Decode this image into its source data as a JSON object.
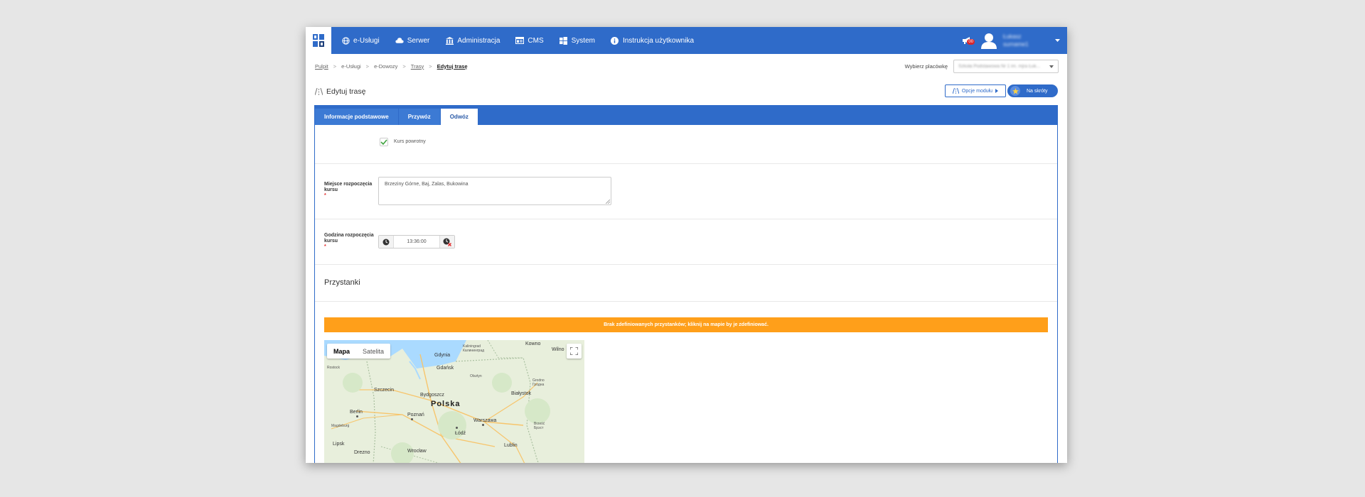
{
  "nav": {
    "items": [
      {
        "label": "e-Usługi",
        "icon": "globe-icon"
      },
      {
        "label": "Serwer",
        "icon": "cloud-icon"
      },
      {
        "label": "Administracja",
        "icon": "building-icon"
      },
      {
        "label": "CMS",
        "icon": "cms-icon"
      },
      {
        "label": "System",
        "icon": "windows-icon"
      },
      {
        "label": "Instrukcja użytkownika",
        "icon": "info-icon"
      }
    ],
    "notification_badge": "00",
    "user_name": "Łukasz",
    "user_surname": "surname1"
  },
  "breadcrumb": {
    "items": [
      "Pulpit",
      "e-Usługi",
      "e-Dowozy",
      "Trasy",
      "Edytuj trasę"
    ],
    "separator": ">"
  },
  "branch": {
    "label": "Wybierz placówkę",
    "value": "Szkoła Podstawowa Nr 1 im. mjra Łuk..."
  },
  "page": {
    "title": "Edytuj trasę",
    "options_button": "Opcje modułu",
    "shortcuts_button": "Na skróty"
  },
  "tabs": [
    "Informacje podstawowe",
    "Przywóz",
    "Odwóz"
  ],
  "form": {
    "return_course_label": "Kurs powrotny",
    "return_course_checked": true,
    "start_place_label": "Miejsce rozpoczęcia kursu",
    "start_place_value": "Brzeziny Górne, Baj, Zalas, Bukowina",
    "start_time_label": "Godzina rozpoczęcia kursu",
    "start_time_value": "13:36:00",
    "required_marker": "*"
  },
  "stops": {
    "title": "Przystanki",
    "alert": "Brak zdefiniowanych przystanków; kliknij na mapie by je zdefiniować."
  },
  "map": {
    "type_map": "Mapa",
    "type_satellite": "Satelita",
    "country_label": "Polska",
    "cities": [
      "Gdynia",
      "Gdańsk",
      "Kaliningrad Калининград",
      "Olsztyn",
      "Szczecin",
      "Bydgoszcz",
      "Białystok",
      "Grodno Гродна",
      "Berlin",
      "Poznań",
      "Warszawa",
      "Brześć Брэст",
      "Łódź",
      "Lipsk",
      "Drezno",
      "Wrocław",
      "Lublin",
      "Kowno",
      "Wilno",
      "Rostock",
      "Magdeburg"
    ]
  }
}
